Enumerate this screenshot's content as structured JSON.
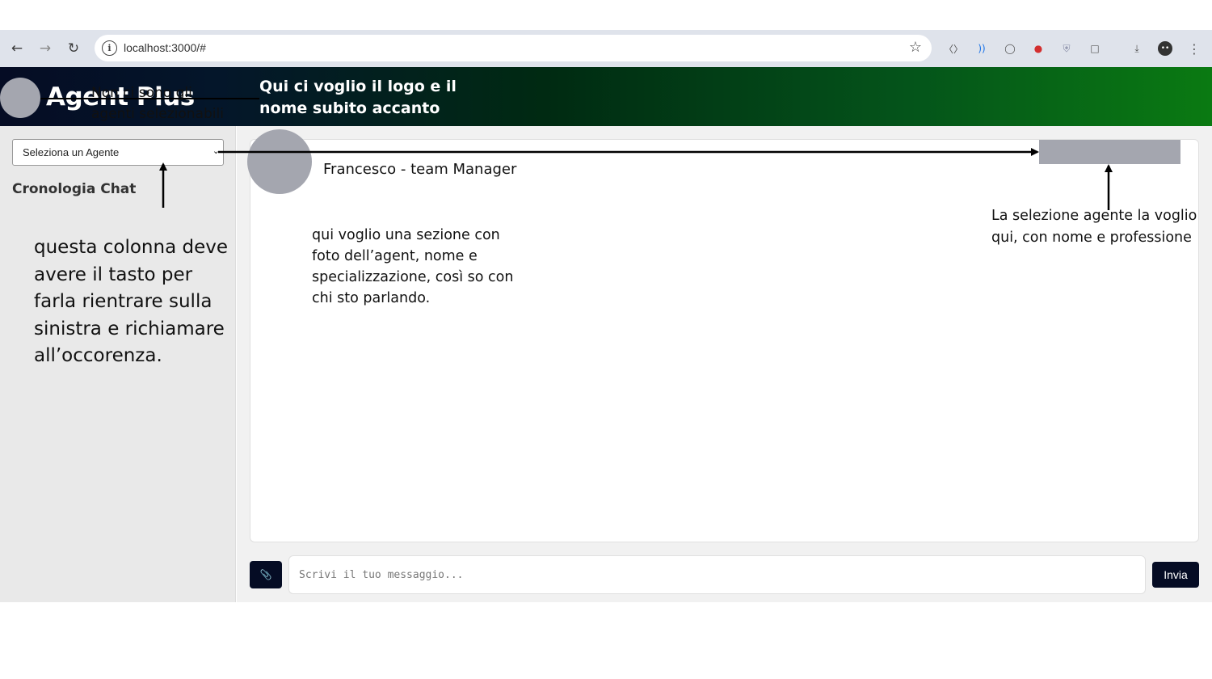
{
  "browser": {
    "url": "localhost:3000/#",
    "back_icon": "arrow-left-icon",
    "forward_icon": "arrow-right-icon",
    "reload_icon": "reload-icon"
  },
  "header": {
    "title": "Agent Plus",
    "note": "Qui ci voglio il logo e il nome subito accanto",
    "gradient": [
      "#050c24",
      "#0a7a12"
    ]
  },
  "sidebar": {
    "select_placeholder": "Seleziona un Agente",
    "history_title": "Cronologia Chat",
    "note_select": "Non  ci sono gli agenti selezionabili",
    "note_column": "questa colonna deve avere il tasto per farla rientrare sulla sinistra e richiamare all’occorenza."
  },
  "main": {
    "agent_name": "Francesco - team Manager",
    "note_section": "qui voglio una sezione con foto dell’agent, nome e specializzazione, così so con chi sto parlando.",
    "note_selection": "La selezione agente la voglio qui, con nome e professione"
  },
  "composer": {
    "placeholder": "Scrivi il tuo messaggio...",
    "send_label": "Invia",
    "attach_icon": "paperclip-icon"
  },
  "colors": {
    "accent_dark": "#050c24",
    "placeholder_gray": "#a4a6af"
  }
}
